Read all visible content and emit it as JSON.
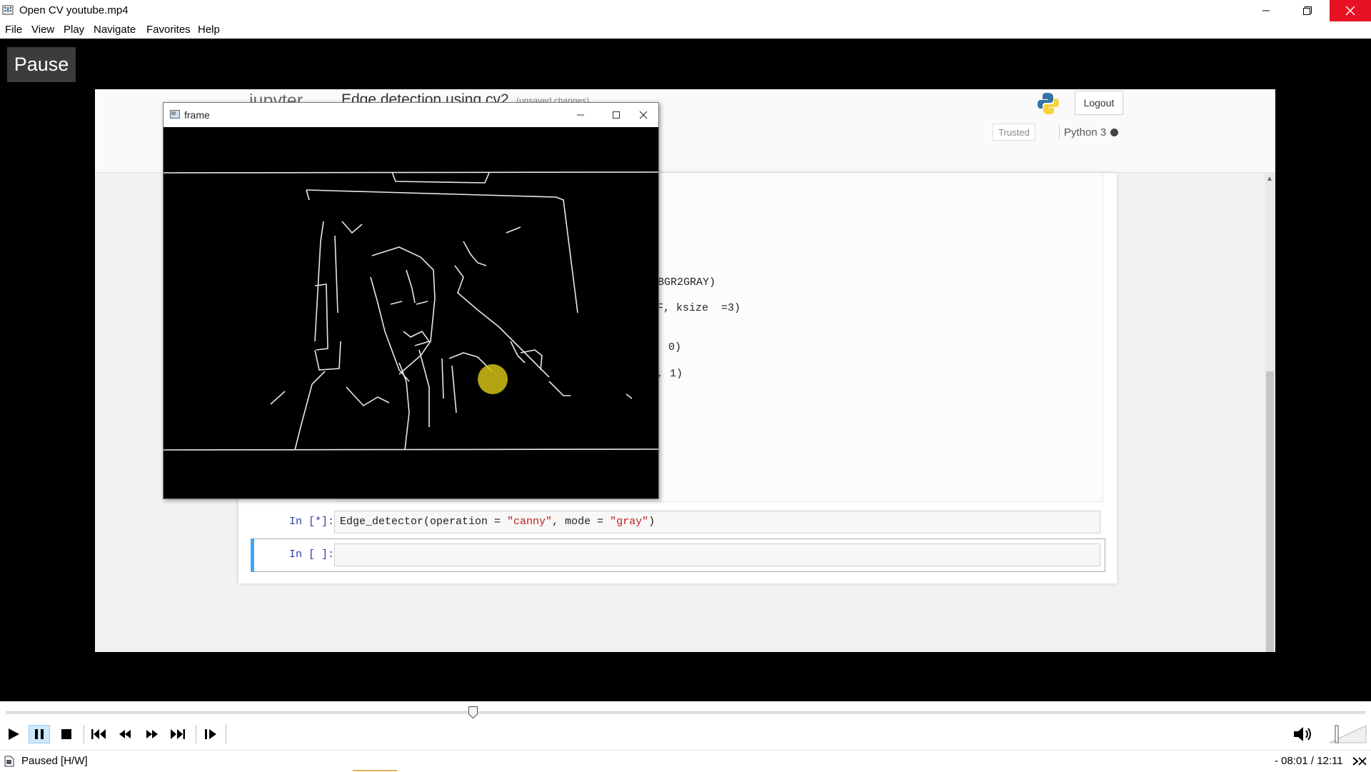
{
  "window": {
    "title": "Open CV youtube.mp4",
    "controls": {
      "minimize": "minimize-icon",
      "maximize": "restore-icon",
      "close": "close-icon"
    }
  },
  "menu": [
    "File",
    "View",
    "Play",
    "Navigate",
    "Favorites",
    "Help"
  ],
  "osd": {
    "label": "Pause"
  },
  "video_content": {
    "jupyter": {
      "logo": "jupyter",
      "notebook_title": "Edge detection using cv2",
      "unsaved": "(unsaved changes)",
      "logout": "Logout",
      "trusted": "Trusted",
      "kernel": "Python 3",
      "code_fragments": [
        "BGR2GRAY)",
        "F, ksize  =3)",
        ", 0)",
        ", 1)"
      ],
      "cell_1": {
        "prompt": "In [*]:",
        "code_before": "Edge_detector(operation = ",
        "arg1": "\"canny\"",
        "code_mid": ", mode = ",
        "arg2": "\"gray\"",
        "code_after": ")"
      },
      "cell_2": {
        "prompt": "In [ ]:"
      }
    },
    "frame_window": {
      "title": "frame"
    }
  },
  "player": {
    "seek_position": 0.3435,
    "buttons": [
      "play-icon",
      "pause-icon",
      "stop-icon",
      "skip-back-icon",
      "rewind-icon",
      "fast-forward-icon",
      "skip-forward-icon",
      "step-frame-icon"
    ],
    "volume_icon": "volume-icon"
  },
  "status": {
    "state": "Paused [H/W]",
    "time": "- 08:01 / 12:11"
  },
  "colors": {
    "close_button": "#e81123",
    "pause_active": "#cde8ff",
    "cursor_highlight": "#d2be14",
    "cell_selected_bar": "#42a5f5"
  }
}
